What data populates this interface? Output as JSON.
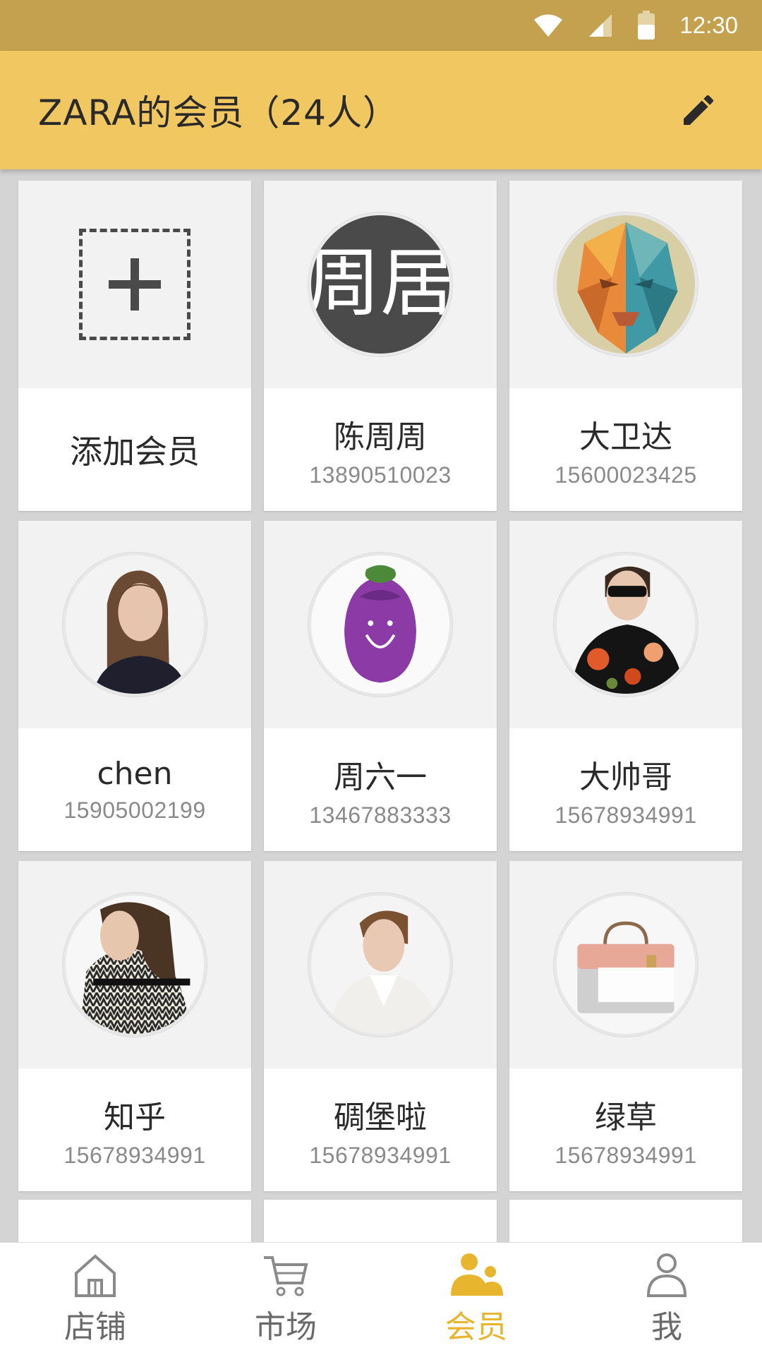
{
  "status_bar": {
    "time": "12:30"
  },
  "app_bar": {
    "title": "ZARA的会员（24人）",
    "edit_icon": "pencil-icon"
  },
  "add_member": {
    "label": "添加会员",
    "icon": "add-dashed-icon"
  },
  "members": [
    {
      "name": "陈周周",
      "phone": "13890510023",
      "avatar": "zhouju-text-avatar"
    },
    {
      "name": "大卫达",
      "phone": "15600023425",
      "avatar": "polygon-face-avatar"
    },
    {
      "name": "chen",
      "phone": "15905002199",
      "avatar": "woman-photo-avatar"
    },
    {
      "name": "周六一",
      "phone": "13467883333",
      "avatar": "eggplant-avatar"
    },
    {
      "name": "大帅哥",
      "phone": "15678934991",
      "avatar": "man-sunglasses-avatar"
    },
    {
      "name": "知乎",
      "phone": "15678934991",
      "avatar": "woman-pattern-avatar"
    },
    {
      "name": "碉堡啦",
      "phone": "15678934991",
      "avatar": "man-white-avatar"
    },
    {
      "name": "绿草",
      "phone": "15678934991",
      "avatar": "handbag-avatar"
    }
  ],
  "avatar_text": {
    "zhouju": "周居"
  },
  "bottom_nav": [
    {
      "label": "店铺",
      "icon": "home-icon",
      "active": false
    },
    {
      "label": "市场",
      "icon": "cart-icon",
      "active": false
    },
    {
      "label": "会员",
      "icon": "members-icon",
      "active": true
    },
    {
      "label": "我",
      "icon": "person-icon",
      "active": false
    }
  ],
  "colors": {
    "status_bar": "#c3a14f",
    "app_bar": "#f1c762",
    "accent": "#e7b52e",
    "background": "#d4d4d4"
  }
}
